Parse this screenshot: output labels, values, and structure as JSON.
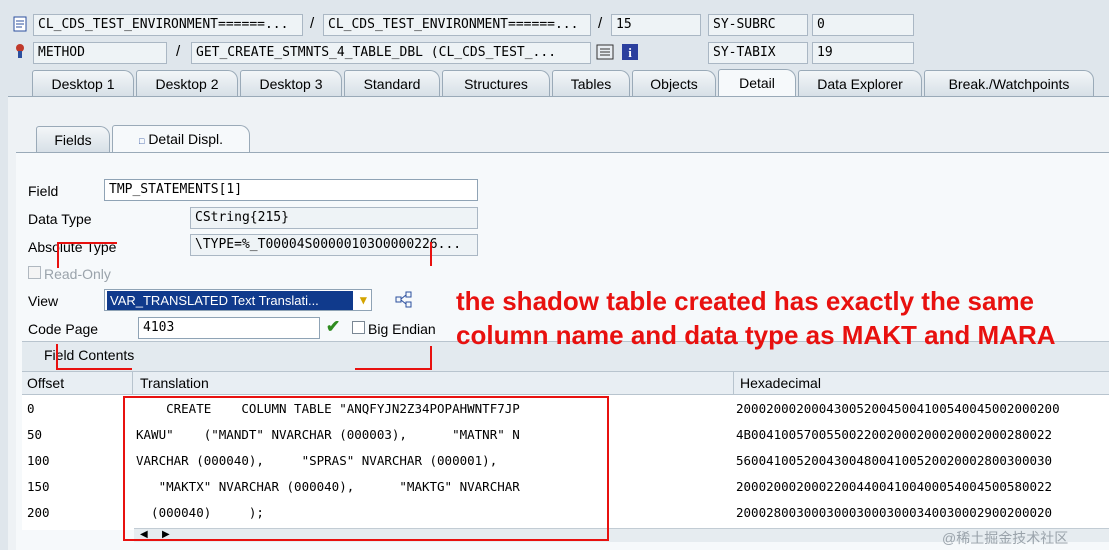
{
  "header": {
    "row1": {
      "program": "CL_CDS_TEST_ENVIRONMENT======...",
      "include": "CL_CDS_TEST_ENVIRONMENT======...",
      "line": "15",
      "sysvar": "SY-SUBRC",
      "sysval": "0"
    },
    "row2": {
      "type": "METHOD",
      "method": "GET_CREATE_STMNTS_4_TABLE_DBL (CL_CDS_TEST_...",
      "sysvar": "SY-TABIX",
      "sysval": "19"
    },
    "sep": "/"
  },
  "tabs": [
    "Desktop 1",
    "Desktop 2",
    "Desktop 3",
    "Standard",
    "Structures",
    "Tables",
    "Objects",
    "Detail",
    "Data Explorer",
    "Break./Watchpoints"
  ],
  "subtabs": [
    "Fields",
    "Detail Displ."
  ],
  "detail": {
    "field_label": "Field",
    "field_value": "TMP_STATEMENTS[1]",
    "datatype_label": "Data Type",
    "datatype_value": "CString{215}",
    "abstype_label": "Absolute Type",
    "abstype_value": "\\TYPE=%_T00004S00000103O0000226...",
    "readonly_label": "Read-Only",
    "view_label": "View",
    "view_value": "VAR_TRANSLATED Text Translati...",
    "codepage_label": "Code Page",
    "codepage_value": "4103",
    "bigendian_label": "Big Endian",
    "section_title": "Field Contents"
  },
  "grid": {
    "headers": [
      "Offset",
      "Translation",
      "Hexadecimal"
    ],
    "rows": [
      {
        "offset": "0",
        "translation": "    CREATE    COLUMN TABLE \"ANQFYJN2Z34POPAHWNTF7JP",
        "hex": "2000200020004300520045004100540045002000200"
      },
      {
        "offset": "50",
        "translation": "KAWU\"    (\"MANDT\" NVARCHAR (000003),      \"MATNR\" N",
        "hex": "4B0041005700550022002000200020002000280022"
      },
      {
        "offset": "100",
        "translation": "VARCHAR (000040),     \"SPRAS\" NVARCHAR (000001),",
        "hex": "560041005200430048004100520020002800300030"
      },
      {
        "offset": "150",
        "translation": "   \"MAKTX\" NVARCHAR (000040),      \"MAKTG\" NVARCHAR",
        "hex": "200020002000220044004100400054004500580022"
      },
      {
        "offset": "200",
        "translation": "  (000040)     );",
        "hex": "200028003000300030003000340030002900200020"
      }
    ]
  },
  "annotation": {
    "text": "the shadow table created has exactly the same column name and data type as MAKT and MARA",
    "color": "#e8110f"
  },
  "watermark": "@稀土掘金技术社区"
}
